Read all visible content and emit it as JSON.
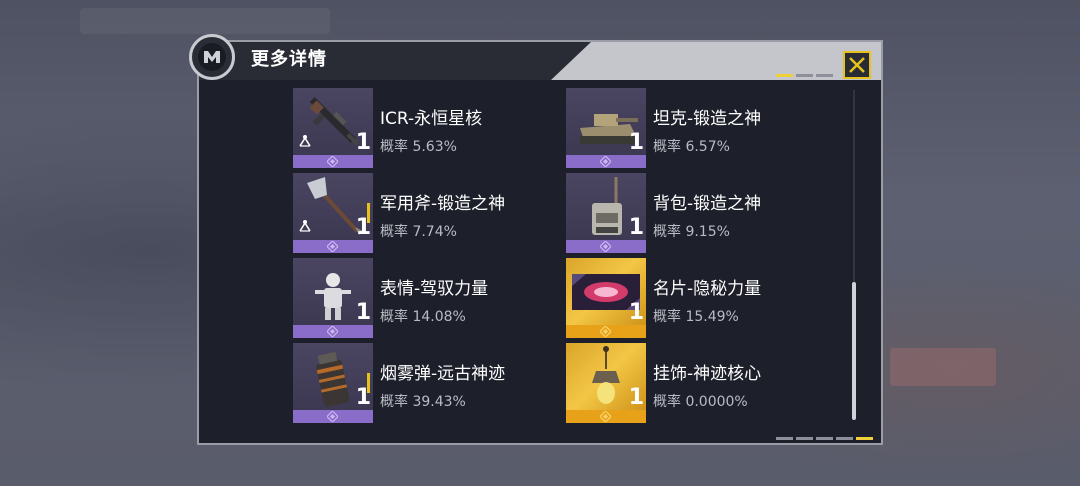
{
  "dialog": {
    "title": "更多详情",
    "close_icon": "close-x-icon",
    "accent_color": "#e8c21c"
  },
  "items": [
    {
      "name": "ICR-永恒星核",
      "prob": "概率 5.63%",
      "qty": "1",
      "rarity": "purple",
      "icon": "rifle-icon"
    },
    {
      "name": "坦克-锻造之神",
      "prob": "概率 6.57%",
      "qty": "1",
      "rarity": "purple",
      "icon": "tank-icon"
    },
    {
      "name": "军用斧-锻造之神",
      "prob": "概率 7.74%",
      "qty": "1",
      "rarity": "purple",
      "icon": "axe-icon"
    },
    {
      "name": "背包-锻造之神",
      "prob": "概率 9.15%",
      "qty": "1",
      "rarity": "purple",
      "icon": "backpack-icon"
    },
    {
      "name": "表情-驾驭力量",
      "prob": "概率 14.08%",
      "qty": "1",
      "rarity": "purple",
      "icon": "emote-icon"
    },
    {
      "name": "名片-隐秘力量",
      "prob": "概率 15.49%",
      "qty": "1",
      "rarity": "gold",
      "icon": "calling-card-icon"
    },
    {
      "name": "烟雾弹-远古神迹",
      "prob": "概率 39.43%",
      "qty": "1",
      "rarity": "purple",
      "icon": "smoke-grenade-icon"
    },
    {
      "name": "挂饰-神迹核心",
      "prob": "概率 0.0000%",
      "qty": "1",
      "rarity": "gold",
      "icon": "charm-icon"
    }
  ],
  "colors": {
    "purple": "#8a6cc9",
    "gold": "#e7a21a"
  }
}
